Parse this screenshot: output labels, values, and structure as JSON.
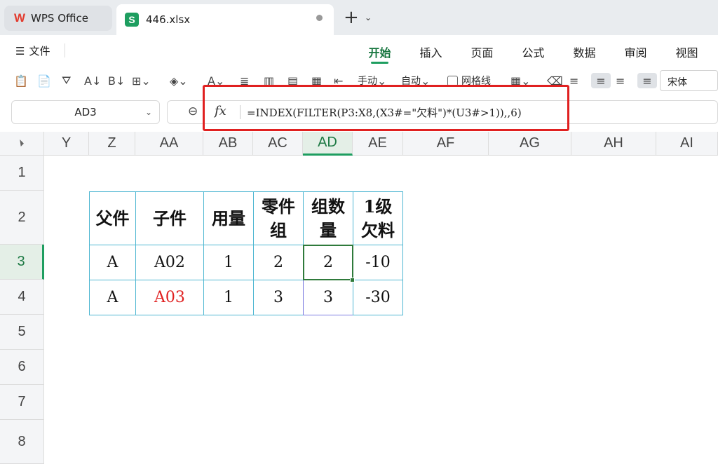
{
  "titlebar": {
    "home_tab": "WPS Office",
    "file_tab": "446.xlsx",
    "add_tab": "+"
  },
  "menubar": {
    "file_menu": "文件",
    "tabs": [
      "开始",
      "插入",
      "页面",
      "公式",
      "数据",
      "审阅",
      "视图"
    ],
    "active_tab": "开始"
  },
  "toolbar": {
    "manual_label": "手动",
    "auto_label": "自动",
    "gridlines_label": "网格线",
    "font_name": "宋体"
  },
  "formula_bar": {
    "name_box": "AD3",
    "fx": "fx",
    "formula": "=INDEX(FILTER(P3:X8,(X3#=\"欠料\")*(U3#>1)),,6)"
  },
  "sheet": {
    "columns": [
      "Y",
      "Z",
      "AA",
      "AB",
      "AC",
      "AD",
      "AE",
      "AF",
      "AG",
      "AH",
      "AI"
    ],
    "active_column": "AD",
    "rows": [
      "1",
      "2",
      "3",
      "4",
      "5",
      "6",
      "7",
      "8"
    ],
    "active_row": "3",
    "table": {
      "headers": [
        "父件",
        "子件",
        "用量",
        "零件组",
        "组数量",
        "1级欠料"
      ],
      "rows": [
        [
          "A",
          "A02",
          "1",
          "2",
          "2",
          "-10"
        ],
        [
          "A",
          "A03",
          "1",
          "3",
          "3",
          "-30"
        ]
      ]
    },
    "colors": {
      "accent_green": "#1e9e60",
      "highlight_box_red": "#e02020",
      "table_border": "#4fb7d2",
      "red_text": "#e02020"
    }
  }
}
